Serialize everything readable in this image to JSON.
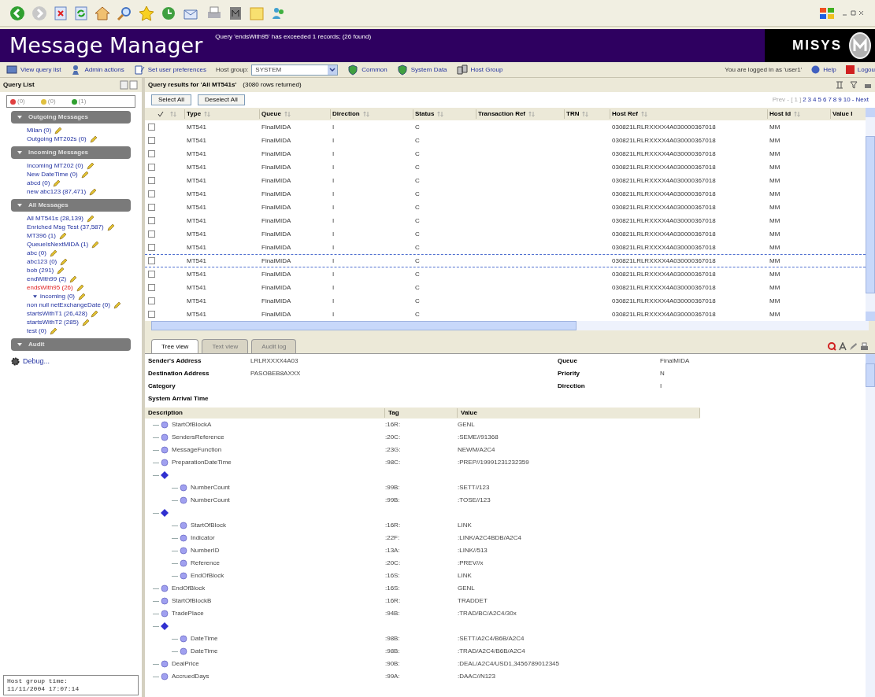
{
  "app": {
    "title": "Message Manager",
    "notice": "Query 'endsWith95' has exceeded 1 records; (26 found)",
    "logo_text": "MISYS"
  },
  "nav": {
    "items": [
      {
        "label": "View query list",
        "kind": "list"
      },
      {
        "label": "Admin actions",
        "kind": "admin"
      },
      {
        "label": "Set user preferences",
        "kind": "prefs"
      }
    ],
    "host_group_label": "Host group:",
    "host_group_value": "SYSTEM",
    "links": [
      {
        "label": "Common",
        "kind": "shield"
      },
      {
        "label": "System Data",
        "kind": "shield"
      },
      {
        "label": "Host Group",
        "kind": "group"
      }
    ],
    "login": "You are logged in as 'user1'",
    "help": "Help",
    "logout": "Logou"
  },
  "query_list": {
    "title": "Query List",
    "counters": [
      {
        "label": "(0)",
        "color": "#e04040"
      },
      {
        "label": "(0)",
        "color": "#e0c040"
      },
      {
        "label": "(1)",
        "color": "#30a030"
      }
    ],
    "sections": [
      {
        "title": "Outgoing Messages",
        "items": [
          {
            "label": "Milan (0)",
            "selected": false
          },
          {
            "label": "Outgoing MT202s (0)",
            "selected": false
          }
        ]
      },
      {
        "title": "Incoming Messages",
        "items": [
          {
            "label": "Incoming MT202 (0)",
            "selected": false
          },
          {
            "label": "New DateTime (0)",
            "selected": false
          },
          {
            "label": "abcd (0)",
            "selected": false
          },
          {
            "label": "new abc123 (87,471)",
            "selected": false
          }
        ]
      },
      {
        "title": "All Messages",
        "items": [
          {
            "label": "All MT541s (28,139)",
            "selected": false
          },
          {
            "label": "Enriched Msg Test (37,587)",
            "selected": false
          },
          {
            "label": "MT396 (1)",
            "selected": false
          },
          {
            "label": "QueueIsNextMIDA (1)",
            "selected": false
          },
          {
            "label": "abc (0)",
            "selected": false
          },
          {
            "label": "abc123 (0)",
            "selected": false
          },
          {
            "label": "bob (291)",
            "selected": false
          },
          {
            "label": "endWith99 (2)",
            "selected": false
          },
          {
            "label": "endsWith95 (26)",
            "selected": true
          },
          {
            "label": "incoming (0)",
            "selected": false,
            "kind": "child"
          },
          {
            "label": "non null netExchangeDate (0)",
            "selected": false
          },
          {
            "label": "startsWithT1 (26,428)",
            "selected": false
          },
          {
            "label": "startsWithT2 (285)",
            "selected": false
          },
          {
            "label": "test (0)",
            "selected": false
          }
        ]
      },
      {
        "title": "Audit"
      }
    ],
    "debug": "Debug...",
    "host_time_label": "Host group time:",
    "host_time": "11/11/2004 17:07:14"
  },
  "results": {
    "title": "Query results for 'All MT541s'",
    "count": "(3080 rows returned)",
    "buttons": [
      "Select All",
      "Deselect All"
    ],
    "pager": {
      "prev": "Prev - [",
      "current": "1",
      "close": "]",
      "pages": [
        "2",
        "3",
        "4",
        "5",
        "6",
        "7",
        "8",
        "9",
        "10"
      ],
      "next": "- Next"
    },
    "columns": [
      "Type",
      "Queue",
      "Direction",
      "Status",
      "Transaction Ref",
      "TRN",
      "Host Ref",
      "Host Id",
      "Value I"
    ],
    "rows": [
      {
        "checked": false,
        "focused": false,
        "cells": [
          "MT541",
          "FinalMIDA",
          "I",
          "C",
          "",
          "",
          "030821LRLRXXXX4A030000367018",
          "MM",
          ""
        ]
      },
      {
        "checked": false,
        "focused": false,
        "cells": [
          "MT541",
          "FinalMIDA",
          "I",
          "C",
          "",
          "",
          "030821LRLRXXXX4A030000367018",
          "MM",
          ""
        ]
      },
      {
        "checked": false,
        "focused": false,
        "cells": [
          "MT541",
          "FinalMIDA",
          "I",
          "C",
          "",
          "",
          "030821LRLRXXXX4A030000367018",
          "MM",
          ""
        ]
      },
      {
        "checked": false,
        "focused": false,
        "cells": [
          "MT541",
          "FinalMIDA",
          "I",
          "C",
          "",
          "",
          "030821LRLRXXXX4A030000367018",
          "MM",
          ""
        ]
      },
      {
        "checked": false,
        "focused": false,
        "cells": [
          "MT541",
          "FinalMIDA",
          "I",
          "C",
          "",
          "",
          "030821LRLRXXXX4A030000367018",
          "MM",
          ""
        ]
      },
      {
        "checked": false,
        "focused": false,
        "cells": [
          "MT541",
          "FinalMIDA",
          "I",
          "C",
          "",
          "",
          "030821LRLRXXXX4A030000367018",
          "MM",
          ""
        ]
      },
      {
        "checked": false,
        "focused": false,
        "cells": [
          "MT541",
          "FinalMIDA",
          "I",
          "C",
          "",
          "",
          "030821LRLRXXXX4A030000367018",
          "MM",
          ""
        ]
      },
      {
        "checked": false,
        "focused": false,
        "cells": [
          "MT541",
          "FinalMIDA",
          "I",
          "C",
          "",
          "",
          "030821LRLRXXXX4A030000367018",
          "MM",
          ""
        ]
      },
      {
        "checked": false,
        "focused": false,
        "cells": [
          "MT541",
          "FinalMIDA",
          "I",
          "C",
          "",
          "",
          "030821LRLRXXXX4A030000367018",
          "MM",
          ""
        ]
      },
      {
        "checked": false,
        "focused": false,
        "cells": [
          "MT541",
          "FinalMIDA",
          "I",
          "C",
          "",
          "",
          "030821LRLRXXXX4A030000367018",
          "MM",
          ""
        ]
      },
      {
        "checked": false,
        "focused": true,
        "cells": [
          "MT541",
          "FinalMIDA",
          "I",
          "C",
          "",
          "",
          "030821LRLRXXXX4A030000367018",
          "MM",
          ""
        ]
      },
      {
        "checked": false,
        "focused": false,
        "cells": [
          "MT541",
          "FinalMIDA",
          "I",
          "C",
          "",
          "",
          "030821LRLRXXXX4A030000367018",
          "MM",
          ""
        ]
      },
      {
        "checked": false,
        "focused": false,
        "cells": [
          "MT541",
          "FinalMIDA",
          "I",
          "C",
          "",
          "",
          "030821LRLRXXXX4A030000367018",
          "MM",
          ""
        ]
      },
      {
        "checked": false,
        "focused": false,
        "cells": [
          "MT541",
          "FinalMIDA",
          "I",
          "C",
          "",
          "",
          "030821LRLRXXXX4A030000367018",
          "MM",
          ""
        ]
      },
      {
        "checked": false,
        "focused": false,
        "cells": [
          "MT541",
          "FinalMIDA",
          "I",
          "C",
          "",
          "",
          "030821LRLRXXXX4A030000367018",
          "MM",
          ""
        ]
      }
    ]
  },
  "detail": {
    "tabs": [
      {
        "label": "Tree view",
        "selected": true
      },
      {
        "label": "Text view",
        "selected": false
      },
      {
        "label": "Audit log",
        "selected": false
      }
    ],
    "fields_left": [
      {
        "label": "Sender's Address",
        "value": "LRLRXXXX4A03"
      },
      {
        "label": "Destination Address",
        "value": "PASOBEB8AXXX"
      },
      {
        "label": "Category"
      },
      {
        "label": "System Arrival Time"
      }
    ],
    "fields_right": [
      {
        "label": "Queue",
        "value": "FinalMIDA"
      },
      {
        "label": "Priority",
        "value": "N"
      },
      {
        "label": "Direction",
        "value": "I"
      }
    ],
    "tree_columns": [
      "Description",
      "Tag",
      "Value"
    ],
    "tree": [
      {
        "name": "StartOfBlockA",
        "tag": ":16R:",
        "value": "GENL"
      },
      {
        "name": "SendersReference",
        "tag": ":20C:",
        "value": ":SEME//91368"
      },
      {
        "name": "MessageFunction",
        "tag": ":23G:",
        "value": "NEWM/A2C4"
      },
      {
        "name": "PreparationDateTime",
        "tag": ":98C:",
        "value": ":PREP//19991231232359"
      },
      {
        "children": [
          {
            "name": "NumberCount",
            "tag": ":99B:",
            "value": ":SETT//123"
          },
          {
            "name": "NumberCount",
            "tag": ":99B:",
            "value": ":TOSE//123"
          }
        ]
      },
      {
        "children": [
          {
            "name": "StartOfBlock",
            "tag": ":16R:",
            "value": "LINK"
          },
          {
            "name": "Indicator",
            "tag": ":22F:",
            "value": ":LINK/A2C4BDB/A2C4"
          },
          {
            "name": "NumberID",
            "tag": ":13A:",
            "value": ":LINK//513"
          },
          {
            "name": "Reference",
            "tag": ":20C:",
            "value": ":PREV//x"
          },
          {
            "name": "EndOfBlock",
            "tag": ":16S:",
            "value": "LINK"
          }
        ]
      },
      {
        "name": "EndOfBlock",
        "tag": ":16S:",
        "value": "GENL"
      },
      {
        "name": "StartOfBlockB",
        "tag": ":16R:",
        "value": "TRADDET"
      },
      {
        "name": "TradePlace",
        "tag": ":94B:",
        "value": ":TRAD/BC/A2C4/30x"
      },
      {
        "children": [
          {
            "name": "DateTime",
            "tag": ":98B:",
            "value": ":SETT/A2C4/B6B/A2C4"
          },
          {
            "name": "DateTime",
            "tag": ":98B:",
            "value": ":TRAD/A2C4/B6B/A2C4"
          }
        ]
      },
      {
        "name": "DealPrice",
        "tag": ":90B:",
        "value": ":DEAL/A2C4/USD1,3456789012345"
      },
      {
        "name": "AccruedDays",
        "tag": ":99A:",
        "value": ":DAAC//N123"
      }
    ]
  }
}
